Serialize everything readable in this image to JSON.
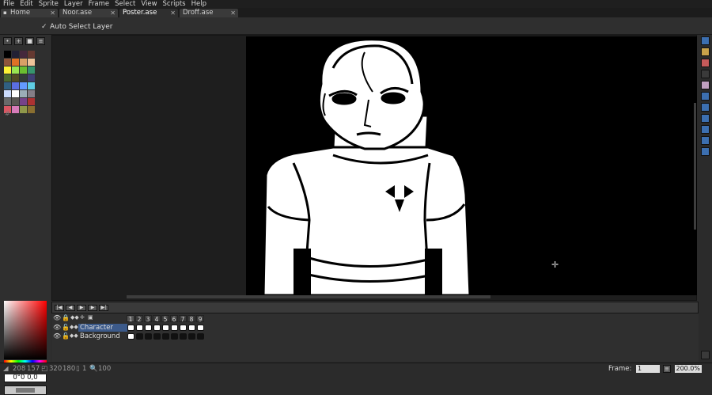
{
  "menu": [
    "File",
    "Edit",
    "Sprite",
    "Layer",
    "Frame",
    "Select",
    "View",
    "Scripts",
    "Help"
  ],
  "tabs": [
    {
      "label": "Home",
      "active": false
    },
    {
      "label": "Noor.ase",
      "active": false
    },
    {
      "label": "Poster.ase",
      "active": true
    },
    {
      "label": "Droff.ase",
      "active": false
    }
  ],
  "context": {
    "auto_select_label": "Auto Select Layer"
  },
  "palette_colors": [
    "#000000",
    "#222034",
    "#45283c",
    "#663931",
    "#8f563b",
    "#df7126",
    "#d9a066",
    "#eec39a",
    "#fbf236",
    "#99e550",
    "#6abe30",
    "#37946e",
    "#4b692f",
    "#524b24",
    "#323c39",
    "#3f3f74",
    "#306082",
    "#5b6ee1",
    "#639bff",
    "#5fcde4",
    "#cbdbfc",
    "#ffffff",
    "#9badb7",
    "#847e87",
    "#696a6a",
    "#595652",
    "#76428a",
    "#ac3232",
    "#d95763",
    "#d77bba",
    "#8f974a",
    "#8a6f30"
  ],
  "color": {
    "hsv_value": "0°0 0,0"
  },
  "timeline": {
    "frames": [
      "1",
      "2",
      "3",
      "4",
      "5",
      "6",
      "7",
      "8",
      "9"
    ],
    "layers": [
      {
        "name": "Character"
      },
      {
        "name": "Background"
      }
    ]
  },
  "status": {
    "coords": "208",
    "coords2": "157",
    "size": "320",
    "size2": "180",
    "layer_count": "1",
    "zoom_readout": "100",
    "frame_label": "Frame:",
    "frame_value": "1",
    "zoom_percent": "200.0%"
  }
}
